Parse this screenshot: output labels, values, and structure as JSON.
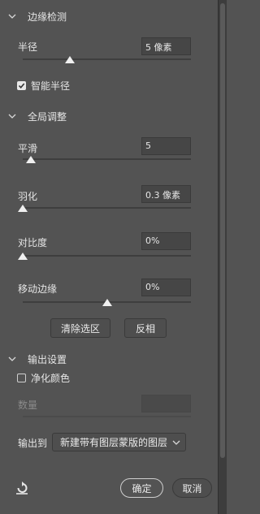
{
  "edge_detection": {
    "title": "边缘检测",
    "radius_label": "半径",
    "radius_value": "5 像素",
    "radius_level": 0.28,
    "smart_radius_label": "智能半径",
    "smart_radius_checked": true
  },
  "global_refinements": {
    "title": "全局调整",
    "smooth_label": "平滑",
    "smooth_value": "5",
    "smooth_level": 0.05,
    "feather_label": "羽化",
    "feather_value": "0.3 像素",
    "feather_level": 0.0,
    "contrast_label": "对比度",
    "contrast_value": "0%",
    "contrast_level": 0.0,
    "shift_edge_label": "移动边缘",
    "shift_edge_value": "0%",
    "shift_edge_level": 0.5,
    "clear_selection_button": "清除选区",
    "invert_button": "反相"
  },
  "output_settings": {
    "title": "输出设置",
    "decontaminate_label": "净化颜色",
    "decontaminate_checked": false,
    "amount_label": "数量",
    "amount_value": "",
    "output_to_label": "输出到",
    "output_to_value": "新建带有图层蒙版的图层"
  },
  "footer": {
    "reset_icon": "reset-icon",
    "ok_button": "确定",
    "cancel_button": "取消"
  },
  "colors": {
    "panel_bg": "#535353",
    "field_bg": "#464646",
    "text": "#e6e6e6"
  }
}
